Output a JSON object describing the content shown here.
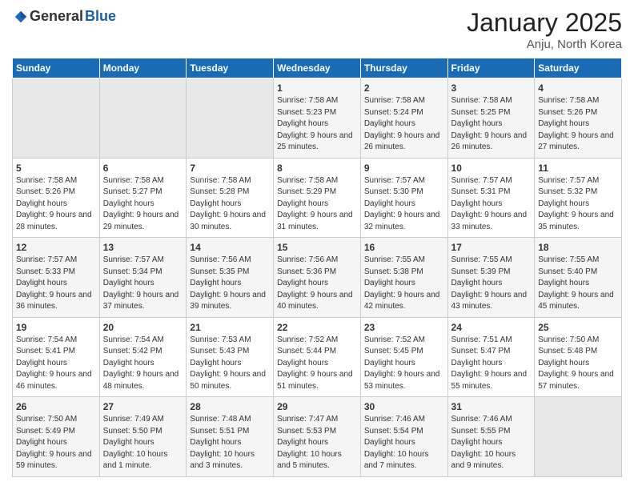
{
  "logo": {
    "general": "General",
    "blue": "Blue"
  },
  "header": {
    "month": "January 2025",
    "location": "Anju, North Korea"
  },
  "weekdays": [
    "Sunday",
    "Monday",
    "Tuesday",
    "Wednesday",
    "Thursday",
    "Friday",
    "Saturday"
  ],
  "weeks": [
    [
      {
        "day": "",
        "empty": true
      },
      {
        "day": "",
        "empty": true
      },
      {
        "day": "",
        "empty": true
      },
      {
        "day": "1",
        "sunrise": "7:58 AM",
        "sunset": "5:23 PM",
        "daylight": "9 hours and 25 minutes."
      },
      {
        "day": "2",
        "sunrise": "7:58 AM",
        "sunset": "5:24 PM",
        "daylight": "9 hours and 26 minutes."
      },
      {
        "day": "3",
        "sunrise": "7:58 AM",
        "sunset": "5:25 PM",
        "daylight": "9 hours and 26 minutes."
      },
      {
        "day": "4",
        "sunrise": "7:58 AM",
        "sunset": "5:26 PM",
        "daylight": "9 hours and 27 minutes."
      }
    ],
    [
      {
        "day": "5",
        "sunrise": "7:58 AM",
        "sunset": "5:26 PM",
        "daylight": "9 hours and 28 minutes."
      },
      {
        "day": "6",
        "sunrise": "7:58 AM",
        "sunset": "5:27 PM",
        "daylight": "9 hours and 29 minutes."
      },
      {
        "day": "7",
        "sunrise": "7:58 AM",
        "sunset": "5:28 PM",
        "daylight": "9 hours and 30 minutes."
      },
      {
        "day": "8",
        "sunrise": "7:58 AM",
        "sunset": "5:29 PM",
        "daylight": "9 hours and 31 minutes."
      },
      {
        "day": "9",
        "sunrise": "7:57 AM",
        "sunset": "5:30 PM",
        "daylight": "9 hours and 32 minutes."
      },
      {
        "day": "10",
        "sunrise": "7:57 AM",
        "sunset": "5:31 PM",
        "daylight": "9 hours and 33 minutes."
      },
      {
        "day": "11",
        "sunrise": "7:57 AM",
        "sunset": "5:32 PM",
        "daylight": "9 hours and 35 minutes."
      }
    ],
    [
      {
        "day": "12",
        "sunrise": "7:57 AM",
        "sunset": "5:33 PM",
        "daylight": "9 hours and 36 minutes."
      },
      {
        "day": "13",
        "sunrise": "7:57 AM",
        "sunset": "5:34 PM",
        "daylight": "9 hours and 37 minutes."
      },
      {
        "day": "14",
        "sunrise": "7:56 AM",
        "sunset": "5:35 PM",
        "daylight": "9 hours and 39 minutes."
      },
      {
        "day": "15",
        "sunrise": "7:56 AM",
        "sunset": "5:36 PM",
        "daylight": "9 hours and 40 minutes."
      },
      {
        "day": "16",
        "sunrise": "7:55 AM",
        "sunset": "5:38 PM",
        "daylight": "9 hours and 42 minutes."
      },
      {
        "day": "17",
        "sunrise": "7:55 AM",
        "sunset": "5:39 PM",
        "daylight": "9 hours and 43 minutes."
      },
      {
        "day": "18",
        "sunrise": "7:55 AM",
        "sunset": "5:40 PM",
        "daylight": "9 hours and 45 minutes."
      }
    ],
    [
      {
        "day": "19",
        "sunrise": "7:54 AM",
        "sunset": "5:41 PM",
        "daylight": "9 hours and 46 minutes."
      },
      {
        "day": "20",
        "sunrise": "7:54 AM",
        "sunset": "5:42 PM",
        "daylight": "9 hours and 48 minutes."
      },
      {
        "day": "21",
        "sunrise": "7:53 AM",
        "sunset": "5:43 PM",
        "daylight": "9 hours and 50 minutes."
      },
      {
        "day": "22",
        "sunrise": "7:52 AM",
        "sunset": "5:44 PM",
        "daylight": "9 hours and 51 minutes."
      },
      {
        "day": "23",
        "sunrise": "7:52 AM",
        "sunset": "5:45 PM",
        "daylight": "9 hours and 53 minutes."
      },
      {
        "day": "24",
        "sunrise": "7:51 AM",
        "sunset": "5:47 PM",
        "daylight": "9 hours and 55 minutes."
      },
      {
        "day": "25",
        "sunrise": "7:50 AM",
        "sunset": "5:48 PM",
        "daylight": "9 hours and 57 minutes."
      }
    ],
    [
      {
        "day": "26",
        "sunrise": "7:50 AM",
        "sunset": "5:49 PM",
        "daylight": "9 hours and 59 minutes."
      },
      {
        "day": "27",
        "sunrise": "7:49 AM",
        "sunset": "5:50 PM",
        "daylight": "10 hours and 1 minute."
      },
      {
        "day": "28",
        "sunrise": "7:48 AM",
        "sunset": "5:51 PM",
        "daylight": "10 hours and 3 minutes."
      },
      {
        "day": "29",
        "sunrise": "7:47 AM",
        "sunset": "5:53 PM",
        "daylight": "10 hours and 5 minutes."
      },
      {
        "day": "30",
        "sunrise": "7:46 AM",
        "sunset": "5:54 PM",
        "daylight": "10 hours and 7 minutes."
      },
      {
        "day": "31",
        "sunrise": "7:46 AM",
        "sunset": "5:55 PM",
        "daylight": "10 hours and 9 minutes."
      },
      {
        "day": "",
        "empty": true
      }
    ]
  ]
}
